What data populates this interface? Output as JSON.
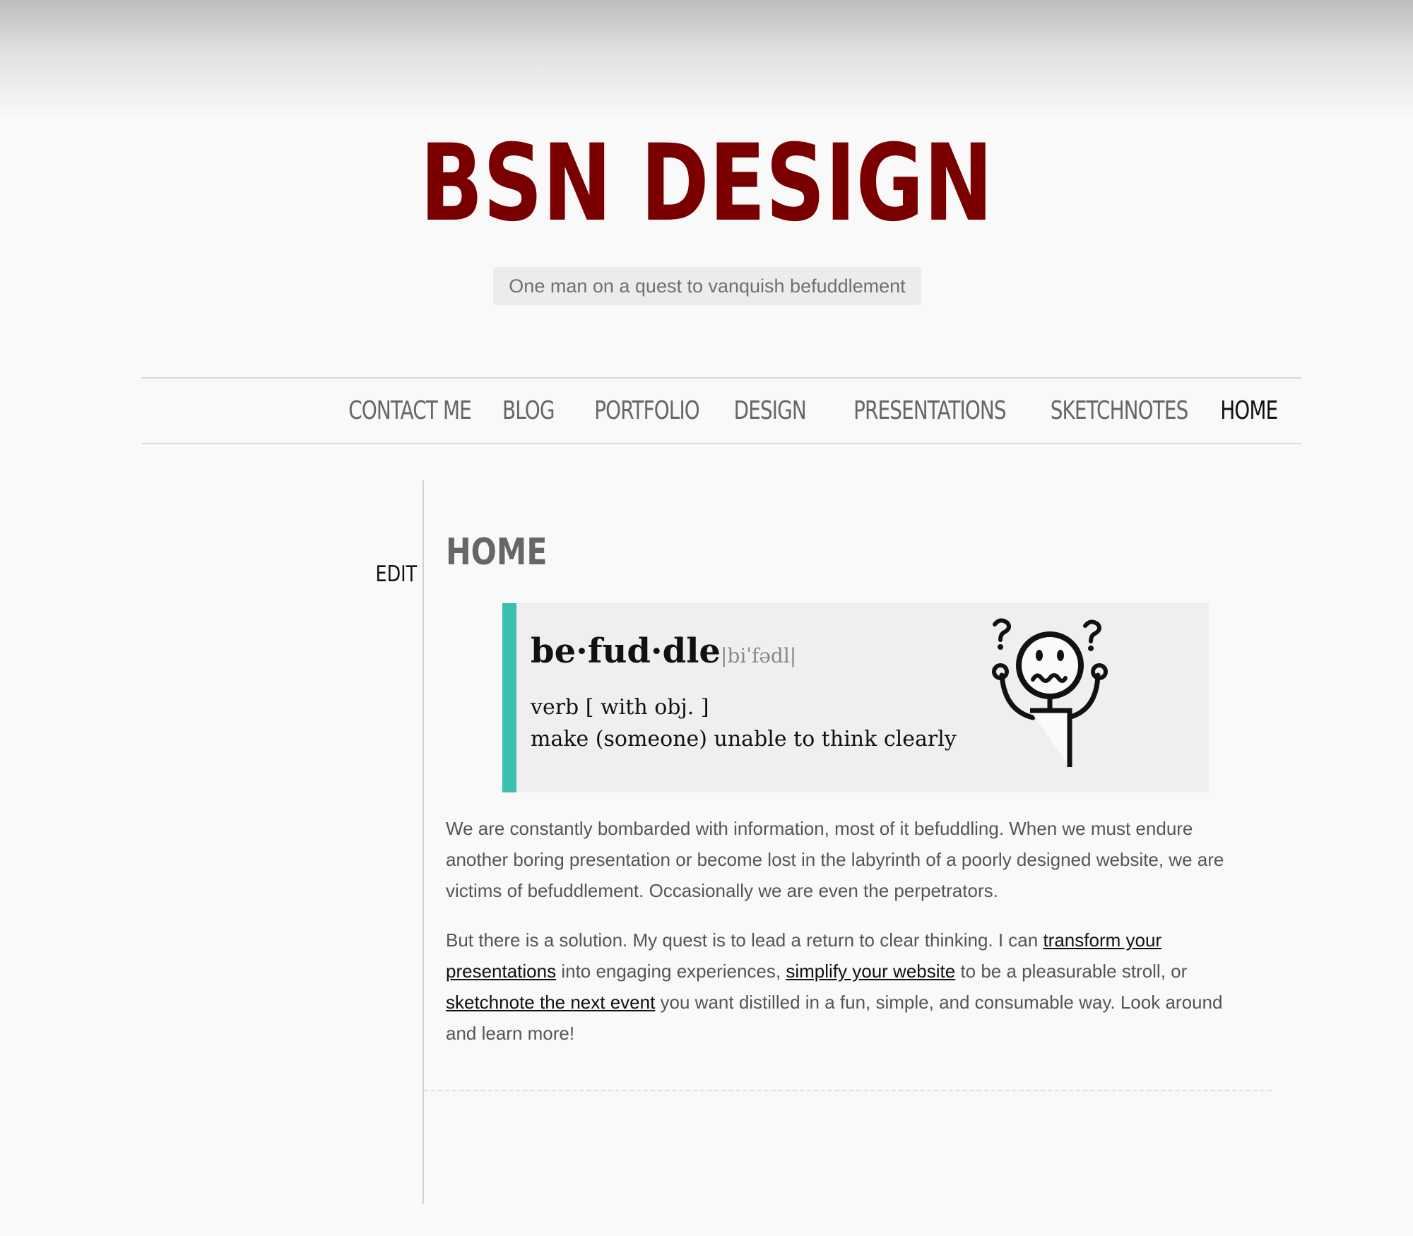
{
  "site": {
    "title": "BSN DESIGN",
    "tagline": "One man on a quest to vanquish befuddlement"
  },
  "nav": {
    "items": [
      {
        "label": "CONTACT ME",
        "active": false
      },
      {
        "label": "BLOG",
        "active": false
      },
      {
        "label": "PORTFOLIO",
        "active": false
      },
      {
        "label": "DESIGN",
        "active": false
      },
      {
        "label": "PRESENTATIONS",
        "active": false
      },
      {
        "label": "SKETCHNOTES",
        "active": false
      },
      {
        "label": "HOME",
        "active": true
      }
    ]
  },
  "sidebar": {
    "edit_label": "EDIT"
  },
  "main": {
    "heading": "HOME",
    "definition": {
      "word": "be·fud·dle",
      "pronunciation": "|biˈfədl|",
      "part_of_speech": "verb [ with obj. ]",
      "meaning": "make (someone) unable to think clearly",
      "illustration_icon": "confused-stick-figure-icon"
    },
    "paragraph1": "We are constantly bombarded with information, most of it befuddling. When we must endure another boring presentation or become lost in the labyrinth of a poorly designed website, we are victims of befuddlement. Occasionally we are even the perpetrators.",
    "paragraph2": {
      "text_1": "But there is a solution. My quest is to lead a return to clear thinking. I can ",
      "link_1": "transform your presentations",
      "text_2": " into engaging experiences, ",
      "link_2": "simplify your website",
      "text_3": " to be a pleasurable stroll, or ",
      "link_3": "sketchnote the next event",
      "text_4": " you want distilled in a fun, simple, and consumable way. Look around and learn more!"
    }
  },
  "colors": {
    "brand": "#7a0000",
    "accent": "#3bbfaf",
    "background": "#f9f9f9"
  }
}
